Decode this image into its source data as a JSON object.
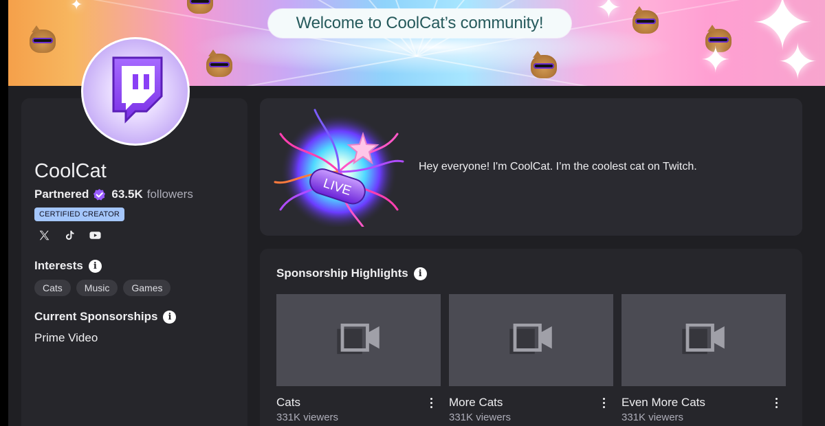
{
  "banner": {
    "welcome_text": "Welcome to CoolCat’s community!"
  },
  "profile": {
    "channel_name": "CoolCat",
    "partner_label": "Partnered",
    "followers_count": "63.5K",
    "followers_label": "followers",
    "certified_badge": "CERTIFIED CREATOR",
    "socials": [
      "x-icon",
      "tiktok-icon",
      "youtube-icon"
    ]
  },
  "interests": {
    "title": "Interests",
    "tags": [
      "Cats",
      "Music",
      "Games"
    ]
  },
  "sponsorships": {
    "title": "Current Sponsorships",
    "current": "Prime Video"
  },
  "about": {
    "live_label": "LIVE",
    "text": "Hey everyone! I'm CoolCat. I’m the coolest cat on Twitch."
  },
  "highlights": {
    "title": "Sponsorship Highlights",
    "videos": [
      {
        "title": "Cats",
        "viewers": "331K viewers"
      },
      {
        "title": "More Cats",
        "viewers": "331K viewers"
      },
      {
        "title": "Even More Cats",
        "viewers": "331K viewers"
      }
    ]
  },
  "colors": {
    "accent_purple": "#9146ff",
    "badge_blue": "#a4c6fb",
    "card_bg": "#26262b"
  }
}
